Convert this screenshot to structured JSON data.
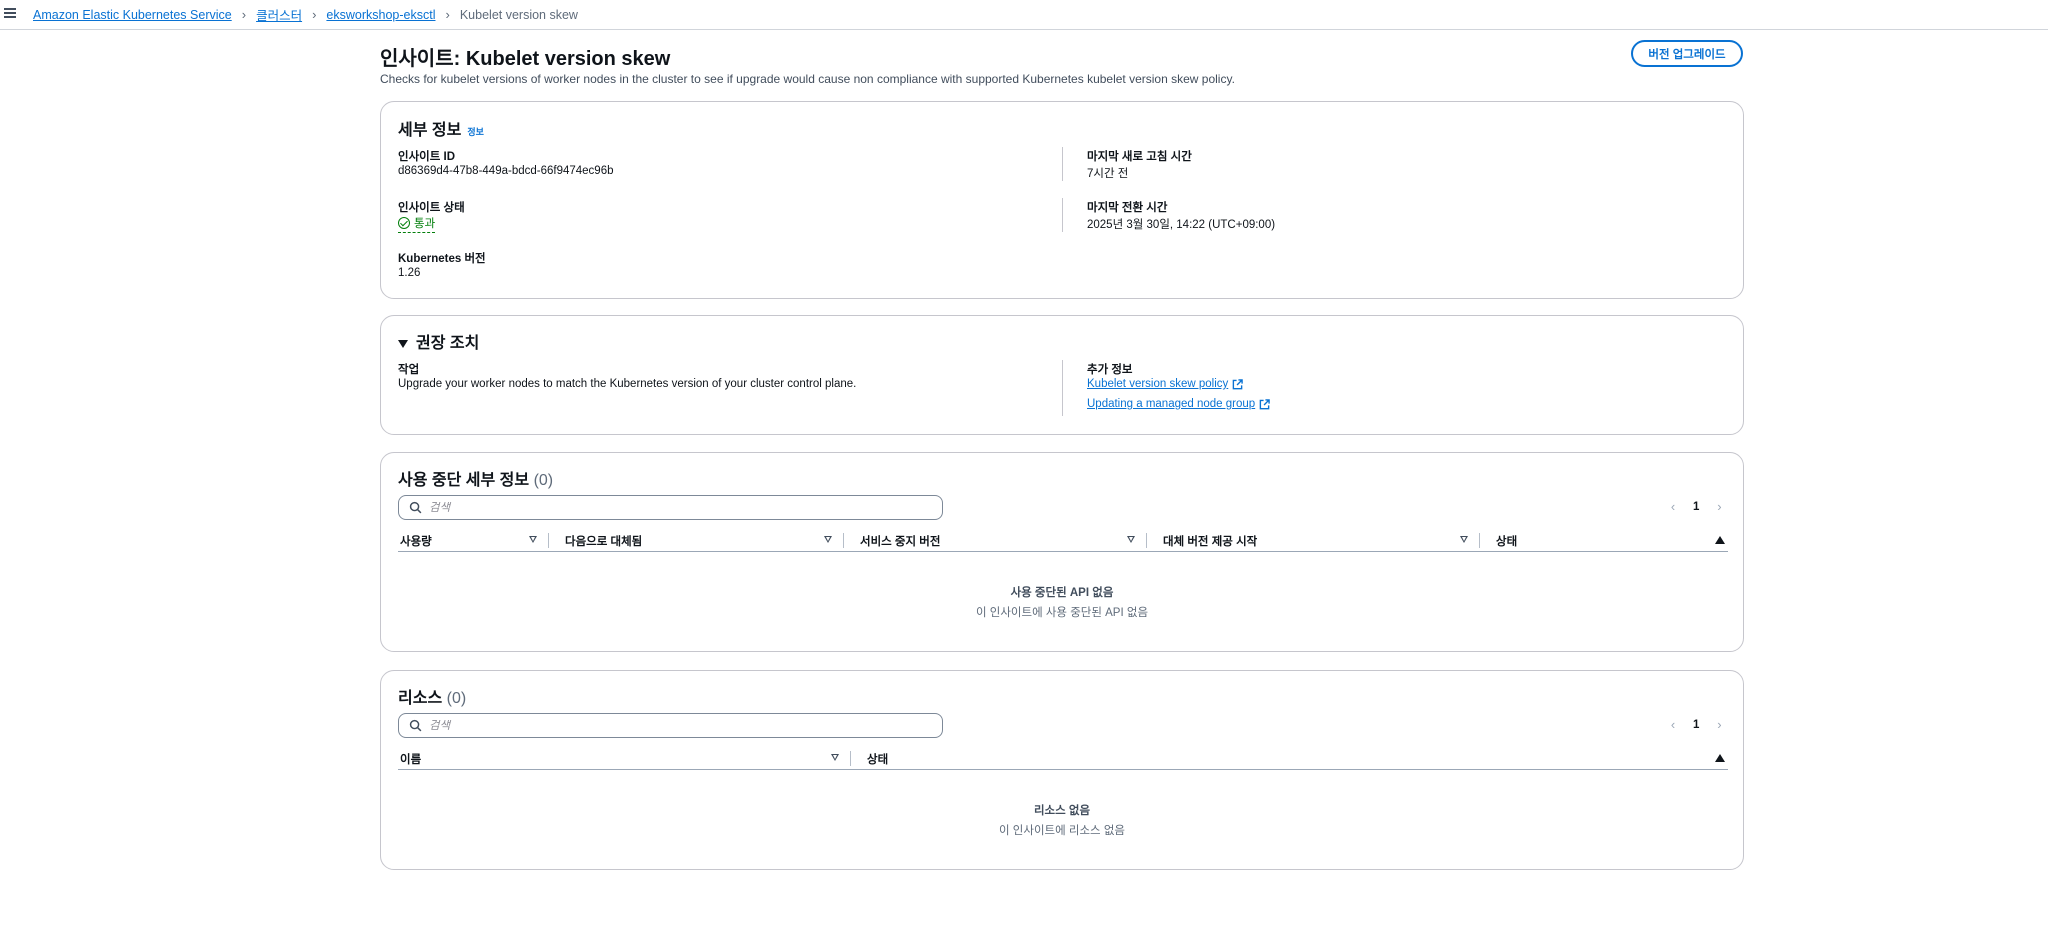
{
  "breadcrumb": {
    "items": [
      "Amazon Elastic Kubernetes Service",
      "클러스터",
      "eksworkshop-eksctl"
    ],
    "current": "Kubelet version skew"
  },
  "header": {
    "title": "인사이트: Kubelet version skew",
    "description": "Checks for kubelet versions of worker nodes in the cluster to see if upgrade would cause non compliance with supported Kubernetes kubelet version skew policy.",
    "upgrade_button": "버전 업그레이드"
  },
  "details": {
    "heading": "세부 정보",
    "info_link": "정보",
    "insight_id_label": "인사이트 ID",
    "insight_id_value": "d86369d4-47b8-449a-bdcd-66f9474ec96b",
    "status_label": "인사이트 상태",
    "status_value": "통과",
    "k8s_version_label": "Kubernetes 버전",
    "k8s_version_value": "1.26",
    "last_refresh_label": "마지막 새로 고침 시간",
    "last_refresh_value": "7시간 전",
    "last_transition_label": "마지막 전환 시간",
    "last_transition_value": "2025년 3월 30일, 14:22 (UTC+09:00)"
  },
  "recommendation": {
    "heading": "권장 조치",
    "task_label": "작업",
    "task_value": "Upgrade your worker nodes to match the Kubernetes version of your cluster control plane.",
    "more_info_label": "추가 정보",
    "links": [
      "Kubelet version skew policy",
      "Updating a managed node group"
    ]
  },
  "deprecation": {
    "heading": "사용 중단 세부 정보",
    "count": "(0)",
    "search_placeholder": "검색",
    "page": "1",
    "columns": [
      "사용량",
      "다음으로 대체됨",
      "서비스 중지 버전",
      "대체 버전 제공 시작",
      "상태"
    ],
    "empty_title": "사용 중단된 API 없음",
    "empty_sub": "이 인사이트에 사용 중단된 API 없음"
  },
  "resources": {
    "heading": "리소스",
    "count": "(0)",
    "search_placeholder": "검색",
    "page": "1",
    "columns": [
      "이름",
      "상태"
    ],
    "empty_title": "리소스 없음",
    "empty_sub": "이 인사이트에 리소스 없음"
  },
  "colors": {
    "link": "#0972d3",
    "success": "#037f0c",
    "border": "#c6c6cd",
    "text": "#0f141a"
  }
}
